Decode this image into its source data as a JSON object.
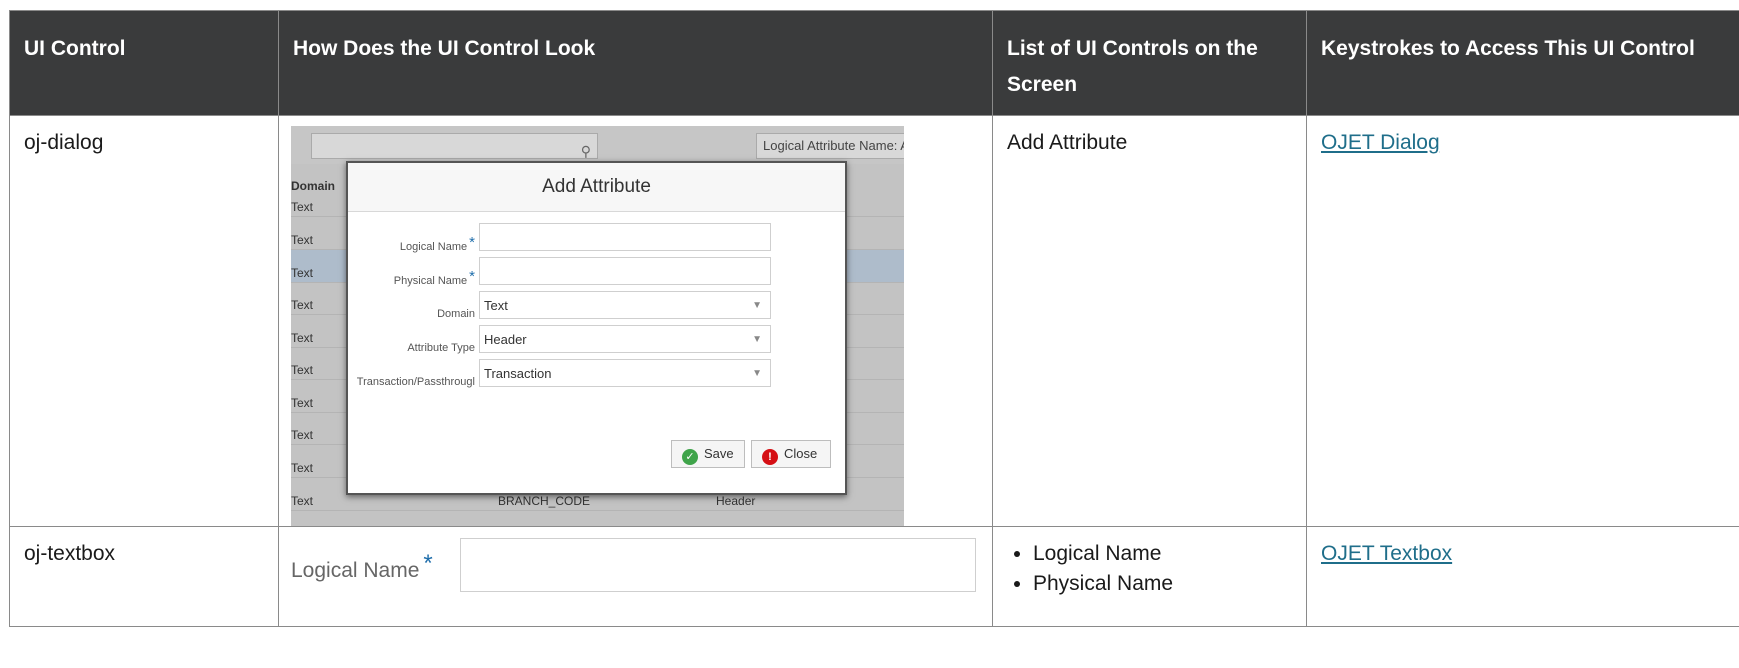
{
  "headers": {
    "ui_control": "UI Control",
    "look": "How Does the UI Control Look",
    "list": "List of UI Controls on the Screen",
    "keys": "Keystrokes to Access This UI Control"
  },
  "rows": [
    {
      "control": "oj-dialog",
      "controls_list": [
        "Add Attribute"
      ],
      "link": "OJET Dialog",
      "screenshot": {
        "top_right_text": "Logical Attribute Name: A",
        "column_header": "Domain",
        "background_rows": [
          "Text",
          "Text",
          "Text",
          "Text",
          "Text",
          "Text",
          "Text",
          "Text",
          "Text"
        ],
        "last_row": {
          "domain": "Text",
          "name": "BRANCH_CODE",
          "type": "Header"
        },
        "dialog": {
          "title": "Add Attribute",
          "fields": {
            "logical_name": "Logical Name",
            "physical_name": "Physical Name",
            "domain_label": "Domain",
            "domain_value": "Text",
            "attribute_type_label": "Attribute Type",
            "attribute_type_value": "Header",
            "trans_label": "Transaction/Passthrougl",
            "trans_value": "Transaction"
          },
          "save": "Save",
          "close": "Close"
        }
      }
    },
    {
      "control": "oj-textbox",
      "controls_list": [
        "Logical Name",
        "Physical Name"
      ],
      "link": "OJET Textbox",
      "screenshot": {
        "label": "Logical Name"
      }
    }
  ]
}
